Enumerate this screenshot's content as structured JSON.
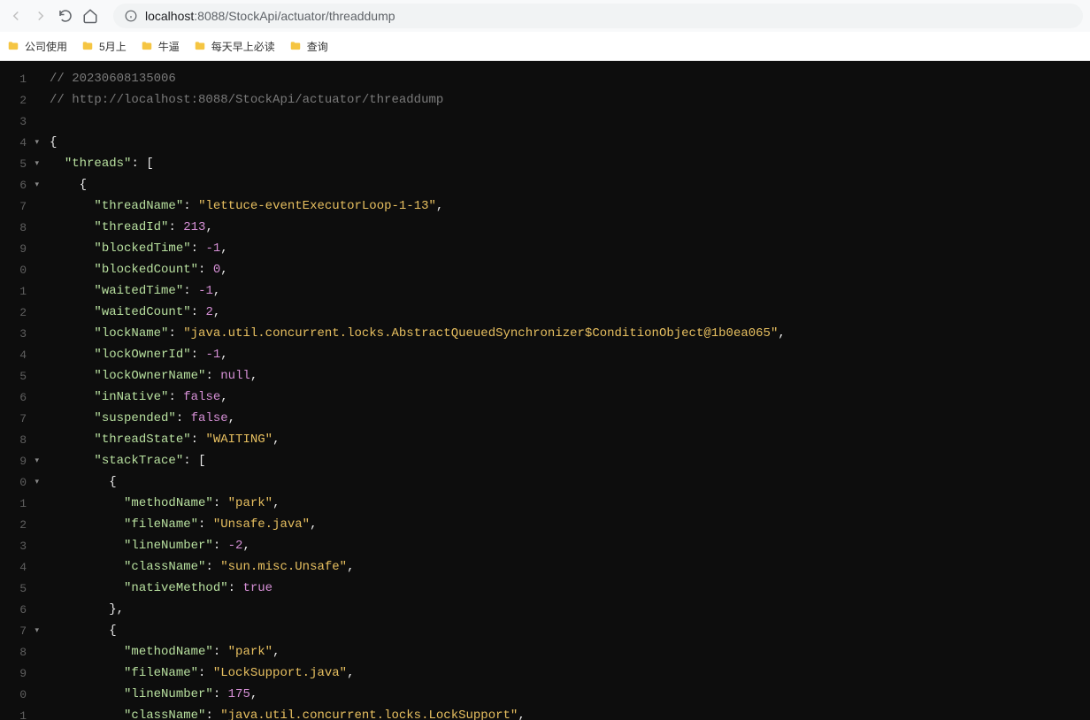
{
  "url": {
    "host": "localhost",
    "port": ":8088",
    "path": "/StockApi/actuator/threaddump"
  },
  "bookmarks": [
    {
      "label": "公司使用"
    },
    {
      "label": "5月上"
    },
    {
      "label": "牛逼"
    },
    {
      "label": "每天早上必读"
    },
    {
      "label": "查询"
    }
  ],
  "code": {
    "lines": [
      {
        "num": "1",
        "fold": "",
        "indent": 0,
        "tokens": [
          {
            "cls": "c-comment",
            "val": "// 20230608135006"
          }
        ]
      },
      {
        "num": "2",
        "fold": "",
        "indent": 0,
        "tokens": [
          {
            "cls": "c-comment",
            "val": "// http://localhost:8088/StockApi/actuator/threaddump"
          }
        ]
      },
      {
        "num": "3",
        "fold": "",
        "indent": 0,
        "tokens": []
      },
      {
        "num": "4",
        "fold": "▾",
        "indent": 0,
        "tokens": [
          {
            "cls": "c-brace",
            "val": "{"
          }
        ]
      },
      {
        "num": "5",
        "fold": "▾",
        "indent": 1,
        "tokens": [
          {
            "cls": "c-key",
            "val": "\"threads\""
          },
          {
            "cls": "c-colon",
            "val": ": "
          },
          {
            "cls": "c-brace",
            "val": "["
          }
        ]
      },
      {
        "num": "6",
        "fold": "▾",
        "indent": 2,
        "tokens": [
          {
            "cls": "c-brace",
            "val": "{"
          }
        ]
      },
      {
        "num": "7",
        "fold": "",
        "indent": 3,
        "tokens": [
          {
            "cls": "c-key",
            "val": "\"threadName\""
          },
          {
            "cls": "c-colon",
            "val": ": "
          },
          {
            "cls": "c-string",
            "val": "\"lettuce-eventExecutorLoop-1-13\""
          },
          {
            "cls": "c-punct",
            "val": ","
          }
        ]
      },
      {
        "num": "8",
        "fold": "",
        "indent": 3,
        "tokens": [
          {
            "cls": "c-key",
            "val": "\"threadId\""
          },
          {
            "cls": "c-colon",
            "val": ": "
          },
          {
            "cls": "c-number",
            "val": "213"
          },
          {
            "cls": "c-punct",
            "val": ","
          }
        ]
      },
      {
        "num": "9",
        "fold": "",
        "indent": 3,
        "tokens": [
          {
            "cls": "c-key",
            "val": "\"blockedTime\""
          },
          {
            "cls": "c-colon",
            "val": ": "
          },
          {
            "cls": "c-number",
            "val": "-1"
          },
          {
            "cls": "c-punct",
            "val": ","
          }
        ]
      },
      {
        "num": "0",
        "fold": "",
        "indent": 3,
        "tokens": [
          {
            "cls": "c-key",
            "val": "\"blockedCount\""
          },
          {
            "cls": "c-colon",
            "val": ": "
          },
          {
            "cls": "c-number",
            "val": "0"
          },
          {
            "cls": "c-punct",
            "val": ","
          }
        ]
      },
      {
        "num": "1",
        "fold": "",
        "indent": 3,
        "tokens": [
          {
            "cls": "c-key",
            "val": "\"waitedTime\""
          },
          {
            "cls": "c-colon",
            "val": ": "
          },
          {
            "cls": "c-number",
            "val": "-1"
          },
          {
            "cls": "c-punct",
            "val": ","
          }
        ]
      },
      {
        "num": "2",
        "fold": "",
        "indent": 3,
        "tokens": [
          {
            "cls": "c-key",
            "val": "\"waitedCount\""
          },
          {
            "cls": "c-colon",
            "val": ": "
          },
          {
            "cls": "c-number",
            "val": "2"
          },
          {
            "cls": "c-punct",
            "val": ","
          }
        ]
      },
      {
        "num": "3",
        "fold": "",
        "indent": 3,
        "tokens": [
          {
            "cls": "c-key",
            "val": "\"lockName\""
          },
          {
            "cls": "c-colon",
            "val": ": "
          },
          {
            "cls": "c-string",
            "val": "\"java.util.concurrent.locks.AbstractQueuedSynchronizer$ConditionObject@1b0ea065\""
          },
          {
            "cls": "c-punct",
            "val": ","
          }
        ]
      },
      {
        "num": "4",
        "fold": "",
        "indent": 3,
        "tokens": [
          {
            "cls": "c-key",
            "val": "\"lockOwnerId\""
          },
          {
            "cls": "c-colon",
            "val": ": "
          },
          {
            "cls": "c-number",
            "val": "-1"
          },
          {
            "cls": "c-punct",
            "val": ","
          }
        ]
      },
      {
        "num": "5",
        "fold": "",
        "indent": 3,
        "tokens": [
          {
            "cls": "c-key",
            "val": "\"lockOwnerName\""
          },
          {
            "cls": "c-colon",
            "val": ": "
          },
          {
            "cls": "c-null",
            "val": "null"
          },
          {
            "cls": "c-punct",
            "val": ","
          }
        ]
      },
      {
        "num": "6",
        "fold": "",
        "indent": 3,
        "tokens": [
          {
            "cls": "c-key",
            "val": "\"inNative\""
          },
          {
            "cls": "c-colon",
            "val": ": "
          },
          {
            "cls": "c-bool",
            "val": "false"
          },
          {
            "cls": "c-punct",
            "val": ","
          }
        ]
      },
      {
        "num": "7",
        "fold": "",
        "indent": 3,
        "tokens": [
          {
            "cls": "c-key",
            "val": "\"suspended\""
          },
          {
            "cls": "c-colon",
            "val": ": "
          },
          {
            "cls": "c-bool",
            "val": "false"
          },
          {
            "cls": "c-punct",
            "val": ","
          }
        ]
      },
      {
        "num": "8",
        "fold": "",
        "indent": 3,
        "tokens": [
          {
            "cls": "c-key",
            "val": "\"threadState\""
          },
          {
            "cls": "c-colon",
            "val": ": "
          },
          {
            "cls": "c-string",
            "val": "\"WAITING\""
          },
          {
            "cls": "c-punct",
            "val": ","
          }
        ]
      },
      {
        "num": "9",
        "fold": "▾",
        "indent": 3,
        "tokens": [
          {
            "cls": "c-key",
            "val": "\"stackTrace\""
          },
          {
            "cls": "c-colon",
            "val": ": "
          },
          {
            "cls": "c-brace",
            "val": "["
          }
        ]
      },
      {
        "num": "0",
        "fold": "▾",
        "indent": 4,
        "tokens": [
          {
            "cls": "c-brace",
            "val": "{"
          }
        ]
      },
      {
        "num": "1",
        "fold": "",
        "indent": 5,
        "tokens": [
          {
            "cls": "c-key",
            "val": "\"methodName\""
          },
          {
            "cls": "c-colon",
            "val": ": "
          },
          {
            "cls": "c-string",
            "val": "\"park\""
          },
          {
            "cls": "c-punct",
            "val": ","
          }
        ]
      },
      {
        "num": "2",
        "fold": "",
        "indent": 5,
        "tokens": [
          {
            "cls": "c-key",
            "val": "\"fileName\""
          },
          {
            "cls": "c-colon",
            "val": ": "
          },
          {
            "cls": "c-string",
            "val": "\"Unsafe.java\""
          },
          {
            "cls": "c-punct",
            "val": ","
          }
        ]
      },
      {
        "num": "3",
        "fold": "",
        "indent": 5,
        "tokens": [
          {
            "cls": "c-key",
            "val": "\"lineNumber\""
          },
          {
            "cls": "c-colon",
            "val": ": "
          },
          {
            "cls": "c-number",
            "val": "-2"
          },
          {
            "cls": "c-punct",
            "val": ","
          }
        ]
      },
      {
        "num": "4",
        "fold": "",
        "indent": 5,
        "tokens": [
          {
            "cls": "c-key",
            "val": "\"className\""
          },
          {
            "cls": "c-colon",
            "val": ": "
          },
          {
            "cls": "c-string",
            "val": "\"sun.misc.Unsafe\""
          },
          {
            "cls": "c-punct",
            "val": ","
          }
        ]
      },
      {
        "num": "5",
        "fold": "",
        "indent": 5,
        "tokens": [
          {
            "cls": "c-key",
            "val": "\"nativeMethod\""
          },
          {
            "cls": "c-colon",
            "val": ": "
          },
          {
            "cls": "c-bool",
            "val": "true"
          }
        ]
      },
      {
        "num": "6",
        "fold": "",
        "indent": 4,
        "tokens": [
          {
            "cls": "c-brace",
            "val": "}"
          },
          {
            "cls": "c-punct",
            "val": ","
          }
        ]
      },
      {
        "num": "7",
        "fold": "▾",
        "indent": 4,
        "tokens": [
          {
            "cls": "c-brace",
            "val": "{"
          }
        ]
      },
      {
        "num": "8",
        "fold": "",
        "indent": 5,
        "tokens": [
          {
            "cls": "c-key",
            "val": "\"methodName\""
          },
          {
            "cls": "c-colon",
            "val": ": "
          },
          {
            "cls": "c-string",
            "val": "\"park\""
          },
          {
            "cls": "c-punct",
            "val": ","
          }
        ]
      },
      {
        "num": "9",
        "fold": "",
        "indent": 5,
        "tokens": [
          {
            "cls": "c-key",
            "val": "\"fileName\""
          },
          {
            "cls": "c-colon",
            "val": ": "
          },
          {
            "cls": "c-string",
            "val": "\"LockSupport.java\""
          },
          {
            "cls": "c-punct",
            "val": ","
          }
        ]
      },
      {
        "num": "0",
        "fold": "",
        "indent": 5,
        "tokens": [
          {
            "cls": "c-key",
            "val": "\"lineNumber\""
          },
          {
            "cls": "c-colon",
            "val": ": "
          },
          {
            "cls": "c-number",
            "val": "175"
          },
          {
            "cls": "c-punct",
            "val": ","
          }
        ]
      },
      {
        "num": "1",
        "fold": "",
        "indent": 5,
        "tokens": [
          {
            "cls": "c-key",
            "val": "\"className\""
          },
          {
            "cls": "c-colon",
            "val": ": "
          },
          {
            "cls": "c-string",
            "val": "\"java.util.concurrent.locks.LockSupport\""
          },
          {
            "cls": "c-punct",
            "val": ","
          }
        ]
      }
    ]
  }
}
